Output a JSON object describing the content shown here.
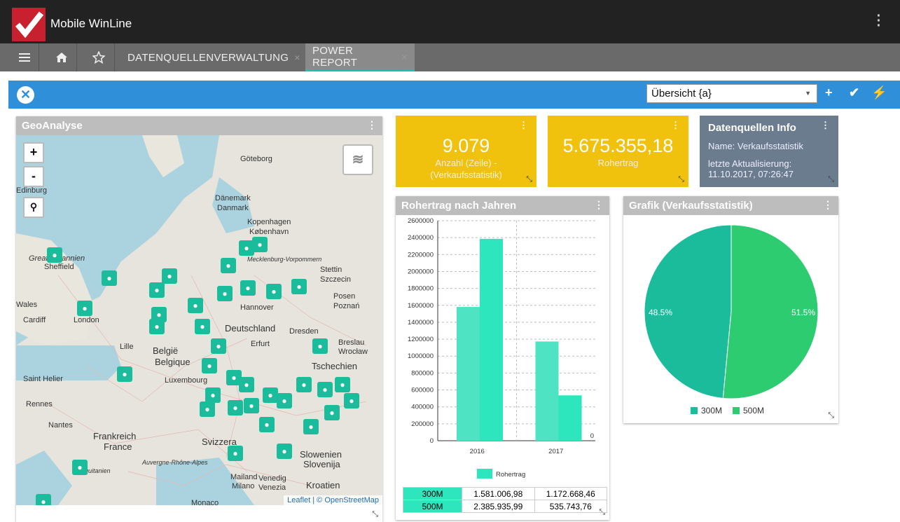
{
  "app": {
    "title": "Mobile WinLine"
  },
  "tabs": [
    {
      "label": "Datenquellenverwaltung",
      "close": "×"
    },
    {
      "label": "Power Report",
      "close": "×"
    }
  ],
  "toolbar": {
    "view_select": "Übersicht {a}"
  },
  "geo": {
    "title": "GeoAnalyse",
    "attribution": "Leaflet | © OpenStreetMap",
    "zoom_in": "+",
    "zoom_out": "-",
    "cities": [
      "Göteborg",
      "Danmark",
      "Dänemark",
      "Kopenhagen",
      "København",
      "Edinburg",
      "Sheffield",
      "Wales",
      "London",
      "Cardiff",
      "Hannover",
      "Deutschland",
      "Dresden",
      "Stettin",
      "Szczecin",
      "Posen",
      "Poznań",
      "Erfurt",
      "Breslau",
      "Wrocław",
      "Belgique",
      "België",
      "Lille",
      "Luxembourg",
      "Tschechien",
      "Saint Helier",
      "Rennes",
      "Nantes",
      "Frankreich",
      "France",
      "Svizzera",
      "Mailand",
      "Milano",
      "Venedig",
      "Venezia",
      "Kroatien",
      "Slowenien",
      "Slovenija",
      "Monaco",
      "Auvergne-Rhône-Alpes",
      "Aquitanien",
      "Great Britannien",
      "Mecklenburg-Vorpommern"
    ]
  },
  "kpis": [
    {
      "value": "9.079",
      "label": "Anzahl (Zeile) - (Verkaufsstatistik)",
      "color": "#f0c10d"
    },
    {
      "value": "5.675.355,18",
      "label": "Rohertrag",
      "color": "#f0c10d"
    }
  ],
  "info": {
    "title": "Datenquellen Info",
    "name": "Name: Verkaufsstatistik",
    "updated_label": "letzte Aktualisierung:",
    "updated_value": "11.10.2017, 07:26:47"
  },
  "bar_panel": {
    "title": "Rohertrag nach Jahren",
    "legend": "Rohertrag"
  },
  "pie_panel": {
    "title": "Grafik (Verkaufsstatistik)"
  },
  "table": [
    {
      "label": "300M",
      "v2016": "1.581.006,98",
      "v2017": "1.172.668,46"
    },
    {
      "label": "500M",
      "v2016": "2.385.935,99",
      "v2017": "535.743,76"
    }
  ],
  "chart_data": [
    {
      "type": "bar",
      "title": "Rohertrag nach Jahren",
      "categories": [
        "2016",
        "2017"
      ],
      "series": [
        {
          "name": "300M",
          "values": [
            1581006.98,
            1172668.46
          ]
        },
        {
          "name": "500M",
          "values": [
            2385935.99,
            535743.76
          ]
        }
      ],
      "legend": [
        "Rohertrag"
      ],
      "ylim": [
        0,
        2600000
      ],
      "yticks": [
        0,
        200000,
        400000,
        600000,
        800000,
        1000000,
        1200000,
        1400000,
        1600000,
        1800000,
        2000000,
        2200000,
        2400000,
        2600000
      ],
      "colors": [
        "#4ee4c3",
        "#2ee6bd"
      ],
      "grid": true
    },
    {
      "type": "pie",
      "title": "Grafik (Verkaufsstatistik)",
      "categories": [
        "300M",
        "500M"
      ],
      "values": [
        48.5,
        51.5
      ],
      "labels": [
        "48.5%",
        "51.5%"
      ],
      "colors": [
        "#1abc9c",
        "#2ecc71"
      ],
      "legend_position": "bottom"
    }
  ]
}
